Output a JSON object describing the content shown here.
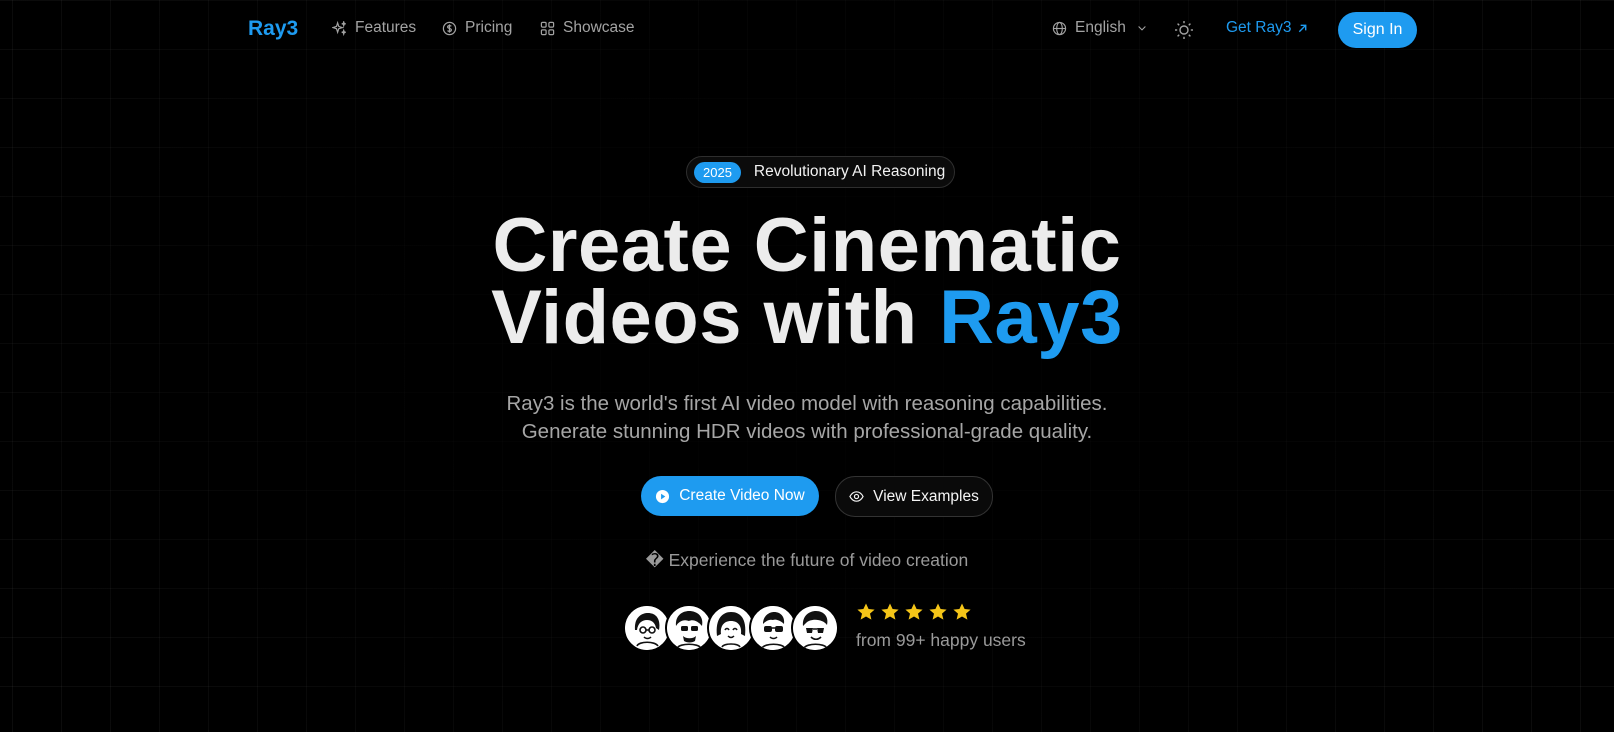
{
  "nav": {
    "logo": "Ray3",
    "links": [
      {
        "label": "Features",
        "icon": "sparkles-icon"
      },
      {
        "label": "Pricing",
        "icon": "coin-icon"
      },
      {
        "label": "Showcase",
        "icon": "grid-icon"
      }
    ],
    "language": "English",
    "get_label": "Get Ray3",
    "signin_label": "Sign In"
  },
  "hero": {
    "badge_year": "2025",
    "badge_text": "Revolutionary AI Reasoning",
    "title_line1": "Create Cinematic",
    "title_line2_prefix": "Videos with ",
    "title_line2_accent": "Ray3",
    "sub_line1": "Ray3 is the world's first AI video model with reasoning capabilities.",
    "sub_line2": "Generate stunning HDR videos with professional-grade quality.",
    "primary_cta": "Create Video Now",
    "secondary_cta": "View Examples",
    "tagline": "� Experience the future of video creation",
    "rating": 5,
    "users_text": "from 99+ happy users"
  },
  "colors": {
    "accent": "#1e9bf0",
    "star": "#f5c518",
    "background": "#000000"
  }
}
